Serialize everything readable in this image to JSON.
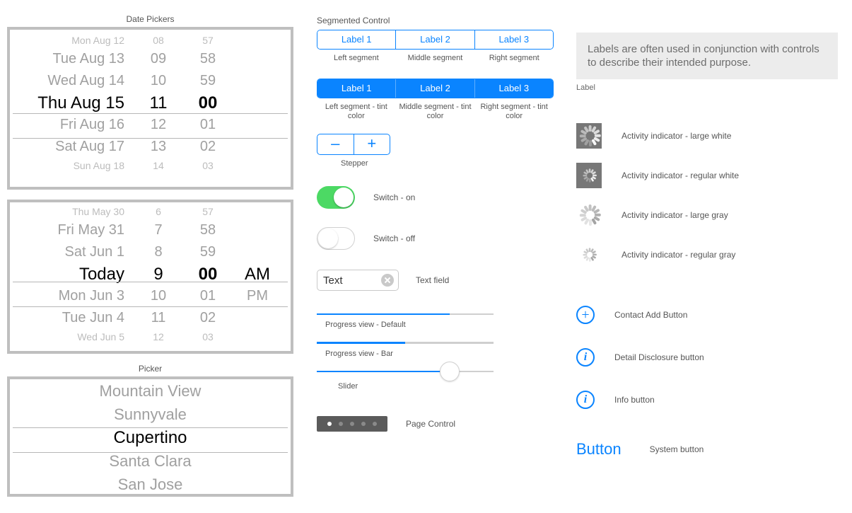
{
  "sections": {
    "date_pickers_title": "Date Pickers",
    "picker_title": "Picker",
    "segmented_title": "Segmented Control",
    "label_title": "Label"
  },
  "datepicker1": {
    "selected_index": 3,
    "rows": [
      {
        "date": "Mon Aug 12",
        "h": "08",
        "m": "57"
      },
      {
        "date": "Tue Aug 13",
        "h": "09",
        "m": "58"
      },
      {
        "date": "Wed Aug 14",
        "h": "10",
        "m": "59"
      },
      {
        "date": "Thu Aug 15",
        "h": "11",
        "m": "00"
      },
      {
        "date": "Fri Aug 16",
        "h": "12",
        "m": "01"
      },
      {
        "date": "Sat Aug 17",
        "h": "13",
        "m": "02"
      },
      {
        "date": "Sun Aug 18",
        "h": "14",
        "m": "03"
      }
    ]
  },
  "datepicker2": {
    "selected_index": 3,
    "rows": [
      {
        "date": "Thu May 30",
        "h": "6",
        "m": "57",
        "ap": ""
      },
      {
        "date": "Fri May 31",
        "h": "7",
        "m": "58",
        "ap": ""
      },
      {
        "date": "Sat Jun 1",
        "h": "8",
        "m": "59",
        "ap": ""
      },
      {
        "date": "Today",
        "h": "9",
        "m": "00",
        "ap": "AM"
      },
      {
        "date": "Mon Jun 3",
        "h": "10",
        "m": "01",
        "ap": "PM"
      },
      {
        "date": "Tue Jun 4",
        "h": "11",
        "m": "02",
        "ap": ""
      },
      {
        "date": "Wed Jun 5",
        "h": "12",
        "m": "03",
        "ap": ""
      }
    ]
  },
  "picker": {
    "selected_index": 2,
    "rows": [
      "Mountain View",
      "Sunnyvale",
      "Cupertino",
      "Santa Clara",
      "San Jose"
    ]
  },
  "segmented": {
    "items": [
      "Label 1",
      "Label 2",
      "Label 3"
    ],
    "cap_plain": [
      "Left segment",
      "Middle segment",
      "Right segment"
    ],
    "cap_tint": [
      "Left segment - tint color",
      "Middle segment - tint color",
      "Right segment - tint color"
    ]
  },
  "stepper": {
    "minus": "–",
    "plus": "+",
    "cap": "Stepper"
  },
  "switch": {
    "cap_on": "Switch - on",
    "cap_off": "Switch - off"
  },
  "textfield": {
    "value": "Text",
    "cap": "Text field"
  },
  "progress": {
    "default_pct": 75,
    "bar_pct": 50,
    "cap_default": "Progress view - Default",
    "cap_bar": "Progress view - Bar"
  },
  "slider": {
    "pct": 75,
    "cap": "Slider"
  },
  "pagecontrol": {
    "count": 5,
    "active_index": 0,
    "cap": "Page Control"
  },
  "label_box": "Labels are often used in conjunction with controls to describe their intended purpose.",
  "activity": {
    "large_white": "Activity indicator - large white",
    "reg_white": "Activity indicator - regular white",
    "large_gray": "Activity indicator - large gray",
    "reg_gray": "Activity indicator - regular gray"
  },
  "buttons": {
    "contact_add": "Contact Add Button",
    "detail": "Detail Disclosure button",
    "info": "Info button",
    "system_text": "Button",
    "system_cap": "System button"
  },
  "colors": {
    "tint": "#0a84ff",
    "switch_on": "#4cd964"
  }
}
